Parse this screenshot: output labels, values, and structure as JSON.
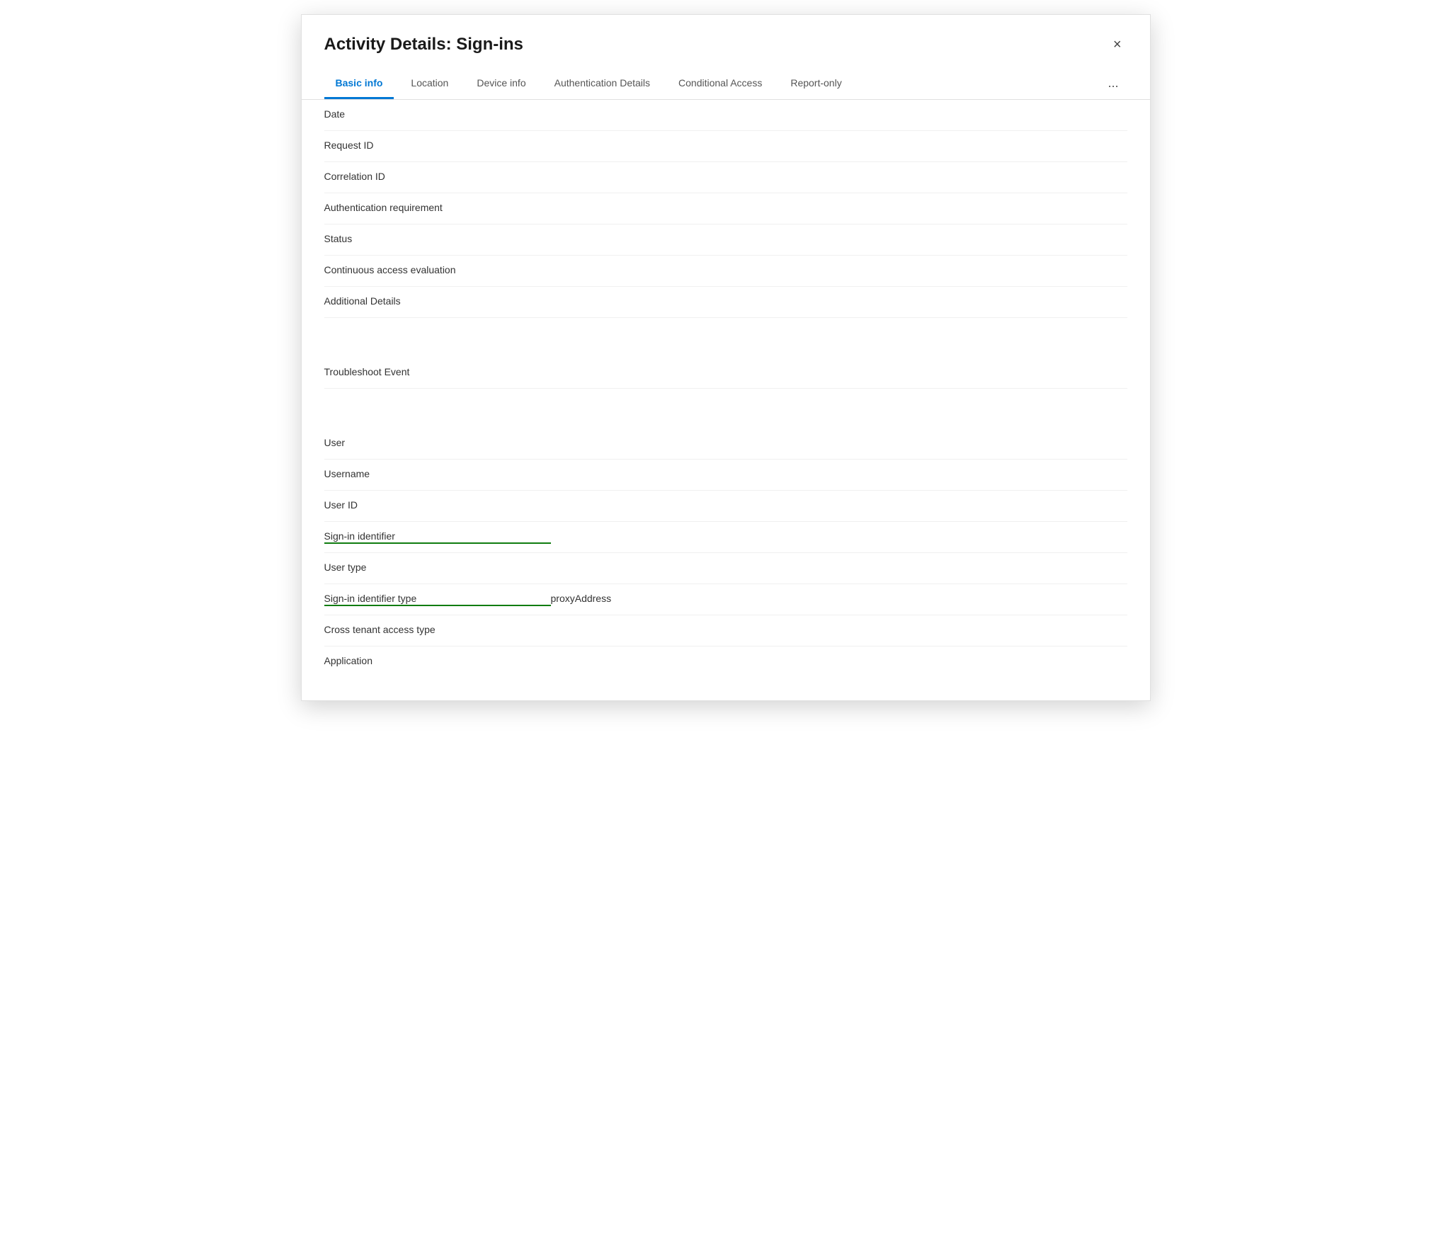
{
  "dialog": {
    "title": "Activity Details: Sign-ins",
    "close_label": "×"
  },
  "tabs": [
    {
      "id": "basic-info",
      "label": "Basic info",
      "active": true
    },
    {
      "id": "location",
      "label": "Location",
      "active": false
    },
    {
      "id": "device-info",
      "label": "Device info",
      "active": false
    },
    {
      "id": "authentication-details",
      "label": "Authentication Details",
      "active": false
    },
    {
      "id": "conditional-access",
      "label": "Conditional Access",
      "active": false
    },
    {
      "id": "report-only",
      "label": "Report-only",
      "active": false
    }
  ],
  "more_label": "...",
  "fields_group1": [
    {
      "id": "date",
      "label": "Date",
      "value": "",
      "green_underline": false
    },
    {
      "id": "request-id",
      "label": "Request ID",
      "value": "",
      "green_underline": false
    },
    {
      "id": "correlation-id",
      "label": "Correlation ID",
      "value": "",
      "green_underline": false
    },
    {
      "id": "authentication-requirement",
      "label": "Authentication requirement",
      "value": "",
      "green_underline": false
    },
    {
      "id": "status",
      "label": "Status",
      "value": "",
      "green_underline": false
    },
    {
      "id": "continuous-access-evaluation",
      "label": "Continuous access evaluation",
      "value": "",
      "green_underline": false
    },
    {
      "id": "additional-details",
      "label": "Additional Details",
      "value": "",
      "green_underline": false
    }
  ],
  "fields_group2": [
    {
      "id": "troubleshoot-event",
      "label": "Troubleshoot Event",
      "value": "",
      "green_underline": false
    }
  ],
  "fields_group3": [
    {
      "id": "user",
      "label": "User",
      "value": "",
      "green_underline": false
    },
    {
      "id": "username",
      "label": "Username",
      "value": "",
      "green_underline": false
    },
    {
      "id": "user-id",
      "label": "User ID",
      "value": "",
      "green_underline": false
    },
    {
      "id": "sign-in-identifier",
      "label": "Sign-in identifier",
      "value": "",
      "green_underline": true
    },
    {
      "id": "user-type",
      "label": "User type",
      "value": "",
      "green_underline": false
    },
    {
      "id": "sign-in-identifier-type",
      "label": "Sign-in identifier type",
      "value": "proxyAddress",
      "green_underline": true
    },
    {
      "id": "cross-tenant-access-type",
      "label": "Cross tenant access type",
      "value": "",
      "green_underline": false
    },
    {
      "id": "application",
      "label": "Application",
      "value": "",
      "green_underline": false
    }
  ]
}
